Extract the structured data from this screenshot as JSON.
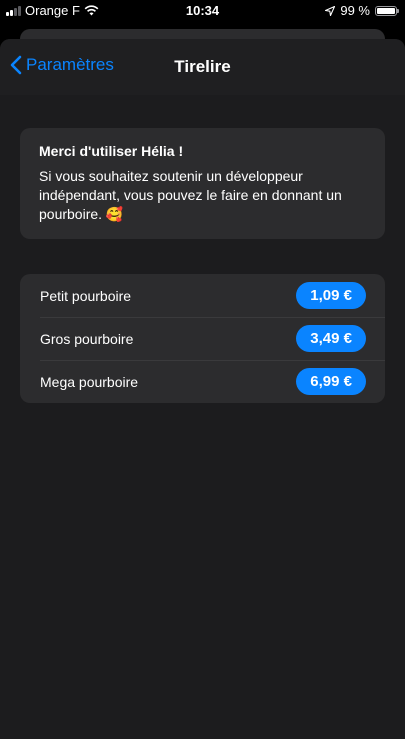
{
  "status_bar": {
    "carrier": "Orange F",
    "time": "10:34",
    "battery": "99 %",
    "battery_level": 0.99
  },
  "nav": {
    "back_label": "Paramètres",
    "title": "Tirelire"
  },
  "intro": {
    "title": "Merci d'utiliser Hélia !",
    "body": "Si vous souhaitez soutenir un développeur indépendant, vous pouvez le faire en donnant un pourboire. 🥰"
  },
  "tips": [
    {
      "label": "Petit pourboire",
      "price": "1,09 €"
    },
    {
      "label": "Gros pourboire",
      "price": "3,49 €"
    },
    {
      "label": "Mega pourboire",
      "price": "6,99 €"
    }
  ],
  "colors": {
    "accent": "#0a84ff",
    "background": "#1c1c1e",
    "card": "#2c2c2e"
  }
}
